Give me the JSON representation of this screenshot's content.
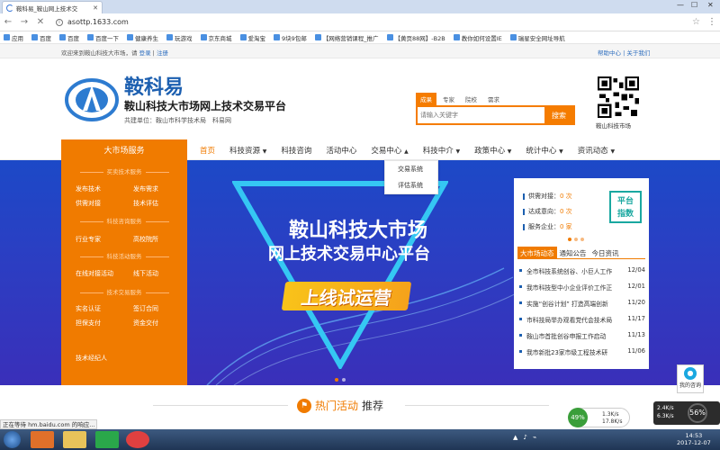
{
  "browser": {
    "tab_title": "鞍科易_鞍山网上技术交",
    "url": "asottp.1633.com",
    "bookmarks": [
      "应用",
      "百度",
      "百度",
      "百度一下",
      "健康养生",
      "玩游戏",
      "京东商城",
      "爱淘宝",
      "9块9包邮",
      "【网络营销课程_推广",
      "【黄页88网】-B2B",
      "教你如何设置IE",
      "瑞星安全网址导航"
    ]
  },
  "topbar": {
    "welcome_text": "欢迎来到鞍山科技大市场，请",
    "login": "登录",
    "sep": "|",
    "register": "注册",
    "help_links": "帮助中心 | 关于我们"
  },
  "header": {
    "site_name": "鞍科易",
    "site_subtitle": "鞍山科技大市场网上技术交易平台",
    "org_line": "共建单位：鞍山市科学技术局　科易网",
    "search_tabs": [
      "成果",
      "专家",
      "院校",
      "需求"
    ],
    "search_placeholder": "请输入关键字",
    "search_button": "搜索",
    "qr_label": "鞍山科技市场"
  },
  "nav": {
    "category": "大市场服务",
    "items": [
      {
        "label": "首页",
        "caret": ""
      },
      {
        "label": "科技资源",
        "caret": "▼"
      },
      {
        "label": "科技咨询",
        "caret": ""
      },
      {
        "label": "活动中心",
        "caret": ""
      },
      {
        "label": "交易中心",
        "caret": "▲"
      },
      {
        "label": "科技中介",
        "caret": "▼"
      },
      {
        "label": "政策中心",
        "caret": "▼"
      },
      {
        "label": "统计中心",
        "caret": "▼"
      },
      {
        "label": "资讯动态",
        "caret": "▼"
      }
    ],
    "dropdown": [
      "交易系统",
      "评估系统"
    ]
  },
  "service": {
    "sections": {
      "buy": "买卖技术服务",
      "consult": "科技咨询服务",
      "activity": "科技活动服务",
      "trade": "技术交易服务"
    },
    "links": {
      "publish_tech": "发布技术",
      "publish_demand": "发布需求",
      "supply_match": "供需对接",
      "tech_assess": "技术评估",
      "industry_expert": "行业专家",
      "university": "高校院所",
      "online_match": "在线对接活动",
      "offline": "线下活动",
      "real_name": "实名认证",
      "sign_contract": "签订合同",
      "escrow": "担保支付",
      "capital": "资金交付",
      "broker": "技术经纪人"
    }
  },
  "banner": {
    "line1": "鞍山科技大市场",
    "line2": "网上技术交易中心平台",
    "stamp": "上线试运营"
  },
  "info_panel": {
    "stats": [
      {
        "label": "供需对接：",
        "value": "0 次"
      },
      {
        "label": "达成意向：",
        "value": "0 次"
      },
      {
        "label": "服务企业：",
        "value": "0 家"
      }
    ],
    "platform_btn": [
      "平台",
      "指数"
    ],
    "tabs": [
      "大市场动态",
      "通知公告",
      "今日资讯"
    ],
    "news": [
      {
        "title": "全市科技系统创谷、小巨人工作",
        "date": "12/04"
      },
      {
        "title": "我市科技型中小企业评价工作正",
        "date": "12/01"
      },
      {
        "title": "实施“创谷计划” 打造高端创新",
        "date": "11/20"
      },
      {
        "title": "市科技局举办观看党代会技术局",
        "date": "11/17"
      },
      {
        "title": "鞍山市首批创谷申报工作启动",
        "date": "11/13"
      },
      {
        "title": "我市新批23家市级工程技术研",
        "date": "11/06"
      }
    ]
  },
  "hot": {
    "prefix": "热门活动",
    "suffix": "推荐"
  },
  "status_text": "正在等待 hm.baidu.com 的响应...",
  "consult_label": "我的咨询",
  "net_widget": {
    "percent": "49%",
    "up": "1.3K/s",
    "down": "17.8K/s"
  },
  "speed_widget": {
    "up": "2.4K/s",
    "down": "6.3K/s",
    "percent": "56%"
  },
  "clock": {
    "time": "14:53",
    "date": "2017-12-07"
  },
  "colors": {
    "accent": "#f07b00",
    "brand": "#1c5fb0",
    "banner": "#2a3fc3"
  }
}
